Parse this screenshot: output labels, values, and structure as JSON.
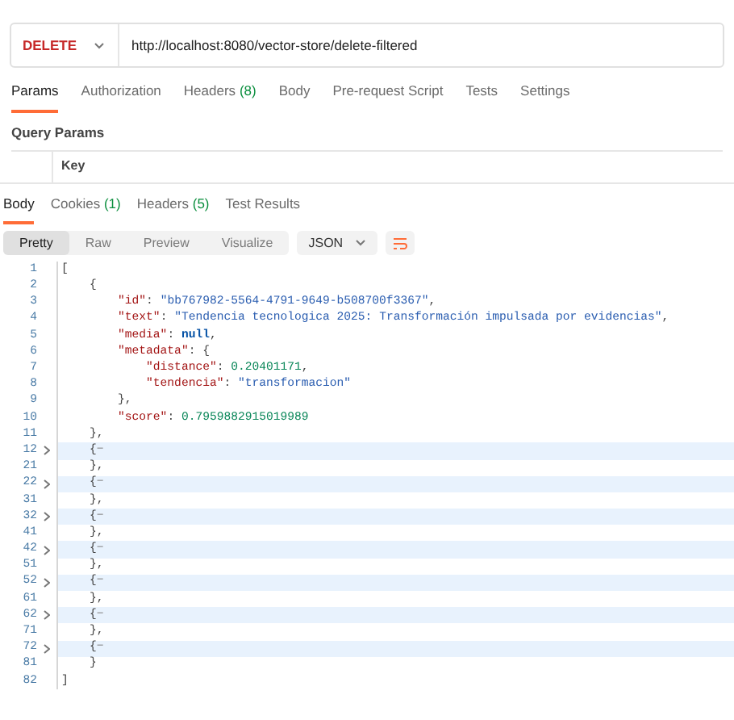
{
  "request": {
    "method": "DELETE",
    "url": "http://localhost:8080/vector-store/delete-filtered"
  },
  "request_tabs": [
    {
      "label": "Params",
      "selected": true
    },
    {
      "label": "Authorization",
      "selected": false
    },
    {
      "label": "Headers",
      "count": "(8)",
      "selected": false
    },
    {
      "label": "Body",
      "selected": false
    },
    {
      "label": "Pre-request Script",
      "selected": false
    },
    {
      "label": "Tests",
      "selected": false
    },
    {
      "label": "Settings",
      "selected": false
    }
  ],
  "query_params": {
    "title": "Query Params",
    "columns": [
      "Key"
    ]
  },
  "response_tabs": [
    {
      "label": "Body",
      "selected": true
    },
    {
      "label": "Cookies",
      "count": "(1)",
      "selected": false
    },
    {
      "label": "Headers",
      "count": "(5)",
      "selected": false
    },
    {
      "label": "Test Results",
      "selected": false
    }
  ],
  "view_modes": [
    {
      "label": "Pretty",
      "selected": true
    },
    {
      "label": "Raw",
      "selected": false
    },
    {
      "label": "Preview",
      "selected": false
    },
    {
      "label": "Visualize",
      "selected": false
    }
  ],
  "format": "JSON",
  "code_lines": [
    {
      "number": "1",
      "folded": false,
      "tokens": [
        {
          "kind": "punct",
          "text": "["
        }
      ]
    },
    {
      "number": "2",
      "folded": false,
      "tokens": [
        {
          "kind": "punct",
          "text": "    {"
        }
      ]
    },
    {
      "number": "3",
      "folded": false,
      "tokens": [
        {
          "kind": "key",
          "text": "        \"id\""
        },
        {
          "kind": "punct",
          "text": ": "
        },
        {
          "kind": "string",
          "text": "\"bb767982-5564-4791-9649-b508700f3367\""
        },
        {
          "kind": "punct",
          "text": ","
        }
      ]
    },
    {
      "number": "4",
      "folded": false,
      "tokens": [
        {
          "kind": "key",
          "text": "        \"text\""
        },
        {
          "kind": "punct",
          "text": ": "
        },
        {
          "kind": "string",
          "text": "\"Tendencia tecnologica 2025: Transformación impulsada por evidencias\""
        },
        {
          "kind": "punct",
          "text": ","
        }
      ]
    },
    {
      "number": "5",
      "folded": false,
      "tokens": [
        {
          "kind": "key",
          "text": "        \"media\""
        },
        {
          "kind": "punct",
          "text": ": "
        },
        {
          "kind": "null",
          "text": "null"
        },
        {
          "kind": "punct",
          "text": ","
        }
      ]
    },
    {
      "number": "6",
      "folded": false,
      "tokens": [
        {
          "kind": "key",
          "text": "        \"metadata\""
        },
        {
          "kind": "punct",
          "text": ": {"
        }
      ]
    },
    {
      "number": "7",
      "folded": false,
      "tokens": [
        {
          "kind": "key",
          "text": "            \"distance\""
        },
        {
          "kind": "punct",
          "text": ": "
        },
        {
          "kind": "number",
          "text": "0.20401171"
        },
        {
          "kind": "punct",
          "text": ","
        }
      ]
    },
    {
      "number": "8",
      "folded": false,
      "tokens": [
        {
          "kind": "key",
          "text": "            \"tendencia\""
        },
        {
          "kind": "punct",
          "text": ": "
        },
        {
          "kind": "string",
          "text": "\"transformacion\""
        }
      ]
    },
    {
      "number": "9",
      "folded": false,
      "tokens": [
        {
          "kind": "punct",
          "text": "        },"
        }
      ]
    },
    {
      "number": "10",
      "folded": false,
      "tokens": [
        {
          "kind": "key",
          "text": "        \"score\""
        },
        {
          "kind": "punct",
          "text": ": "
        },
        {
          "kind": "number",
          "text": "0.7959882915019989"
        }
      ]
    },
    {
      "number": "11",
      "folded": false,
      "tokens": [
        {
          "kind": "punct",
          "text": "    },"
        }
      ]
    },
    {
      "number": "12",
      "folded": true,
      "tokens": [
        {
          "kind": "punct",
          "text": "    {"
        },
        {
          "kind": "fold",
          "text": "−"
        }
      ]
    },
    {
      "number": "21",
      "folded": false,
      "tokens": [
        {
          "kind": "punct",
          "text": "    },"
        }
      ]
    },
    {
      "number": "22",
      "folded": true,
      "tokens": [
        {
          "kind": "punct",
          "text": "    {"
        },
        {
          "kind": "fold",
          "text": "−"
        }
      ]
    },
    {
      "number": "31",
      "folded": false,
      "tokens": [
        {
          "kind": "punct",
          "text": "    },"
        }
      ]
    },
    {
      "number": "32",
      "folded": true,
      "tokens": [
        {
          "kind": "punct",
          "text": "    {"
        },
        {
          "kind": "fold",
          "text": "−"
        }
      ]
    },
    {
      "number": "41",
      "folded": false,
      "tokens": [
        {
          "kind": "punct",
          "text": "    },"
        }
      ]
    },
    {
      "number": "42",
      "folded": true,
      "tokens": [
        {
          "kind": "punct",
          "text": "    {"
        },
        {
          "kind": "fold",
          "text": "−"
        }
      ]
    },
    {
      "number": "51",
      "folded": false,
      "tokens": [
        {
          "kind": "punct",
          "text": "    },"
        }
      ]
    },
    {
      "number": "52",
      "folded": true,
      "tokens": [
        {
          "kind": "punct",
          "text": "    {"
        },
        {
          "kind": "fold",
          "text": "−"
        }
      ]
    },
    {
      "number": "61",
      "folded": false,
      "tokens": [
        {
          "kind": "punct",
          "text": "    },"
        }
      ]
    },
    {
      "number": "62",
      "folded": true,
      "tokens": [
        {
          "kind": "punct",
          "text": "    {"
        },
        {
          "kind": "fold",
          "text": "−"
        }
      ]
    },
    {
      "number": "71",
      "folded": false,
      "tokens": [
        {
          "kind": "punct",
          "text": "    },"
        }
      ]
    },
    {
      "number": "72",
      "folded": true,
      "tokens": [
        {
          "kind": "punct",
          "text": "    {"
        },
        {
          "kind": "fold",
          "text": "−"
        }
      ]
    },
    {
      "number": "81",
      "folded": false,
      "tokens": [
        {
          "kind": "punct",
          "text": "    }"
        }
      ]
    },
    {
      "number": "82",
      "folded": false,
      "tokens": [
        {
          "kind": "punct",
          "text": "]"
        }
      ]
    }
  ]
}
